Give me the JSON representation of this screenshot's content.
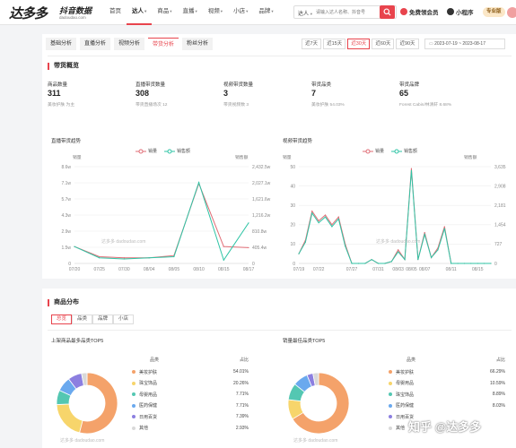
{
  "brand": {
    "name": "达多多",
    "subtitle": "抖音数据",
    "url": "dadoudao.com"
  },
  "nav": [
    {
      "label": "首页",
      "caret": false,
      "active": false
    },
    {
      "label": "达人",
      "caret": true,
      "active": true
    },
    {
      "label": "商品",
      "caret": true,
      "active": false
    },
    {
      "label": "直播",
      "caret": true,
      "active": false
    },
    {
      "label": "视频",
      "caret": true,
      "active": false
    },
    {
      "label": "小店",
      "caret": true,
      "active": false
    },
    {
      "label": "品牌",
      "caret": true,
      "active": false
    }
  ],
  "search": {
    "type_label": "达人",
    "placeholder": "请输入达人名称、抖音号"
  },
  "topbar": {
    "member_label": "免费领会员",
    "miniapp_label": "小程序",
    "vip_label": "专业版"
  },
  "tabs": [
    "基础分析",
    "直播分析",
    "视频分析",
    "带货分析",
    "粉丝分析"
  ],
  "range_buttons": [
    "近7天",
    "近15天",
    "近30天",
    "近60天",
    "近90天"
  ],
  "date_range": "2023-07-19 ~ 2023-08-17",
  "overview": {
    "title": "带货概览",
    "stats": [
      {
        "label": "商品数量",
        "value": "311",
        "sub": "美妆护肤 为主"
      },
      {
        "label": "直播带货数量",
        "value": "308",
        "sub": "带货直播场次 12"
      },
      {
        "label": "视频带货数量",
        "value": "3",
        "sub": "带货视频数 3"
      },
      {
        "label": "带货品类",
        "value": "7",
        "sub": "美妆护肤 54.03%"
      },
      {
        "label": "带货品牌",
        "value": "65",
        "sub": "Forest Cabin/林清轩 8.68%"
      }
    ]
  },
  "live_chart_title": "直播带货趋势",
  "video_chart_title": "视频带货趋势",
  "chart_data": [
    {
      "type": "line",
      "x": [
        "07/20",
        "07/25",
        "07/30",
        "08/04",
        "08/05",
        "08/10",
        "08/15",
        "08/17"
      ],
      "left_axis_name": "销量",
      "right_axis_name": "销售额",
      "left_ticks": [
        "0",
        "1.5w",
        "2.9w",
        "4.3w",
        "5.7w",
        "7.1w",
        "8.6w"
      ],
      "right_ticks": [
        "0",
        "405.4w",
        "810.8w",
        "1,216.2w",
        "1,621.6w",
        "2,027.1w",
        "2,432.5w"
      ],
      "ylim_left": [
        0,
        8.6
      ],
      "series": [
        {
          "name": "销量",
          "color": "#e06c75",
          "values": [
            1.5,
            0.6,
            0.5,
            0.5,
            0.7,
            7.1,
            1.5,
            1.4
          ]
        },
        {
          "name": "销售额",
          "color": "#2ec4a5",
          "values": [
            1.5,
            0.5,
            0.4,
            0.5,
            0.6,
            7.2,
            0.3,
            3.6
          ]
        }
      ]
    },
    {
      "type": "line",
      "x": [
        "07/19",
        "07/20",
        "07/21",
        "07/22",
        "07/23",
        "07/24",
        "07/25",
        "07/26",
        "07/27",
        "07/28",
        "07/29",
        "07/30",
        "07/31",
        "08/01",
        "08/02",
        "08/03",
        "08/04",
        "08/05",
        "08/06",
        "08/07",
        "08/08",
        "08/09",
        "08/10",
        "08/11",
        "08/12",
        "08/13",
        "08/14",
        "08/15",
        "08/16",
        "08/17"
      ],
      "x_ticks": [
        "07/19",
        "07/22",
        "07/27",
        "07/31",
        "08/03",
        "08/05",
        "08/07",
        "08/11",
        "08/15"
      ],
      "left_axis_name": "销量",
      "right_axis_name": "销售额",
      "left_ticks": [
        "0",
        "10",
        "20",
        "30",
        "40",
        "50"
      ],
      "right_ticks": [
        "0",
        "727",
        "1,454",
        "2,181",
        "2,908",
        "3,635"
      ],
      "ylim_left": [
        0,
        50
      ],
      "series": [
        {
          "name": "销量",
          "color": "#e06c75",
          "values": [
            5,
            12,
            27,
            22,
            25,
            20,
            24,
            10,
            0,
            0,
            0,
            2,
            0,
            0,
            1,
            7,
            2,
            49,
            2,
            16,
            3,
            8,
            19,
            0,
            0,
            0,
            0,
            0,
            0,
            0
          ]
        },
        {
          "name": "销售额",
          "color": "#2ec4a5",
          "values": [
            5,
            11,
            26,
            21,
            24,
            19,
            23,
            9,
            0,
            0,
            0,
            2,
            0,
            0,
            1,
            6,
            2,
            48,
            2,
            15,
            3,
            7,
            18,
            0,
            0,
            0,
            0,
            0,
            0,
            0
          ]
        }
      ]
    },
    {
      "type": "pie",
      "title": "上架商品最多品类TOP5",
      "head": [
        "品类",
        "占比"
      ],
      "rows": [
        {
          "name": "美妆护肤",
          "value": 54.01,
          "label": "54.01%",
          "color": "#f4a26a"
        },
        {
          "name": "珠宝饰品",
          "value": 20.26,
          "label": "20.26%",
          "color": "#f7d56b"
        },
        {
          "name": "母婴用品",
          "value": 7.71,
          "label": "7.71%",
          "color": "#54c7b2"
        },
        {
          "name": "医药保健",
          "value": 7.71,
          "label": "7.71%",
          "color": "#6aa9ee"
        },
        {
          "name": "日用百货",
          "value": 7.39,
          "label": "7.39%",
          "color": "#8c7fe0"
        },
        {
          "name": "其他",
          "value": 2.93,
          "label": "2.93%",
          "color": "#d9d9d9"
        }
      ]
    },
    {
      "type": "pie",
      "title": "销量最佳品类TOP5",
      "head": [
        "品类",
        "占比"
      ],
      "rows": [
        {
          "name": "美妆护肤",
          "value": 66.29,
          "label": "66.29%",
          "color": "#f4a26a"
        },
        {
          "name": "母婴用品",
          "value": 10.59,
          "label": "10.59%",
          "color": "#f7d56b"
        },
        {
          "name": "珠宝饰品",
          "value": 8.89,
          "label": "8.89%",
          "color": "#54c7b2"
        },
        {
          "name": "医药保健",
          "value": 8.03,
          "label": "8.03%",
          "color": "#6aa9ee"
        },
        {
          "name": "日用百货",
          "value": 3.2,
          "label": "",
          "color": "#8c7fe0"
        },
        {
          "name": "其他",
          "value": 3.0,
          "label": "",
          "color": "#d9d9d9"
        }
      ]
    }
  ],
  "distribution": {
    "title": "商品分布",
    "subtabs": [
      "品类",
      "品牌",
      "小店"
    ]
  },
  "watermark": "达多多 dadoudao.com",
  "zhihu": "知乎 @达多多"
}
